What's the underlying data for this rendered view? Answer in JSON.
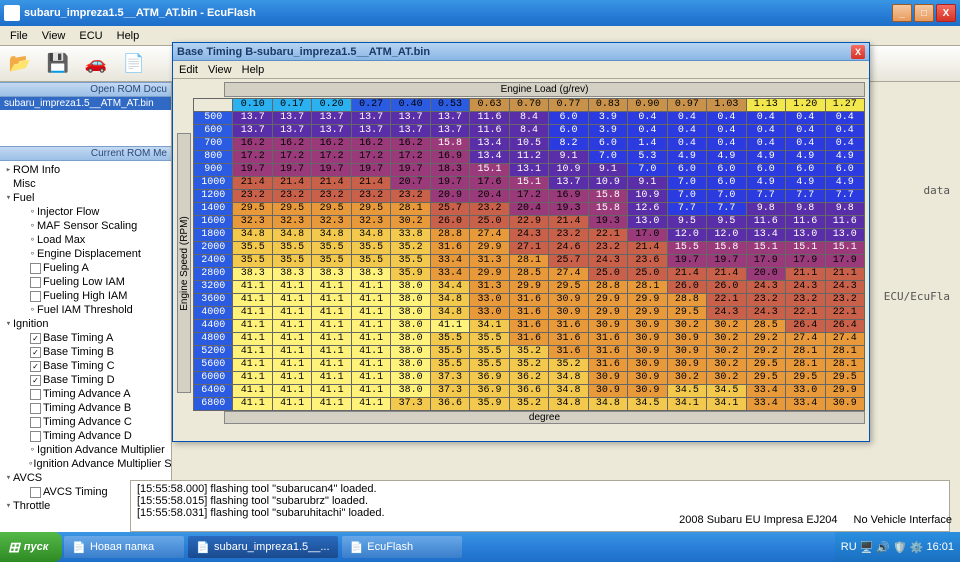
{
  "window": {
    "title": "subaru_impreza1.5__ATM_AT.bin - EcuFlash"
  },
  "menubar": [
    "File",
    "View",
    "ECU",
    "Help"
  ],
  "leftpanel": {
    "hdr1": "Open ROM Docu",
    "rom": "subaru_impreza1.5__ATM_AT.bin",
    "hdr2": "Current ROM Me"
  },
  "tree": [
    {
      "lvl": 0,
      "tw": "▸",
      "txt": "ROM Info"
    },
    {
      "lvl": 0,
      "tw": "",
      "txt": "Misc"
    },
    {
      "lvl": 0,
      "tw": "▾",
      "txt": "Fuel"
    },
    {
      "lvl": 2,
      "tw": "∘",
      "txt": "Injector Flow"
    },
    {
      "lvl": 2,
      "tw": "∘",
      "txt": "MAF Sensor Scaling"
    },
    {
      "lvl": 2,
      "tw": "∘",
      "txt": "Load Max"
    },
    {
      "lvl": 2,
      "tw": "∘",
      "txt": "Engine Displacement"
    },
    {
      "lvl": 2,
      "cb": "",
      "txt": "Fueling A"
    },
    {
      "lvl": 2,
      "cb": "",
      "txt": "Fueling Low IAM"
    },
    {
      "lvl": 2,
      "cb": "",
      "txt": "Fueling High IAM"
    },
    {
      "lvl": 2,
      "tw": "∘",
      "txt": "Fuel IAM Threshold"
    },
    {
      "lvl": 0,
      "tw": "▾",
      "txt": "Ignition"
    },
    {
      "lvl": 2,
      "cb": "✓",
      "txt": "Base Timing A"
    },
    {
      "lvl": 2,
      "cb": "✓",
      "txt": "Base Timing B"
    },
    {
      "lvl": 2,
      "cb": "✓",
      "txt": "Base Timing C"
    },
    {
      "lvl": 2,
      "cb": "✓",
      "txt": "Base Timing D"
    },
    {
      "lvl": 2,
      "cb": "",
      "txt": "Timing Advance A"
    },
    {
      "lvl": 2,
      "cb": "",
      "txt": "Timing Advance B"
    },
    {
      "lvl": 2,
      "cb": "",
      "txt": "Timing Advance C"
    },
    {
      "lvl": 2,
      "cb": "",
      "txt": "Timing Advance D"
    },
    {
      "lvl": 2,
      "tw": "∘",
      "txt": "Ignition Advance Multiplier"
    },
    {
      "lvl": 2,
      "tw": "∘",
      "txt": "Ignition Advance Multiplier Step"
    },
    {
      "lvl": 0,
      "tw": "▾",
      "txt": "AVCS"
    },
    {
      "lvl": 2,
      "cb": "",
      "txt": "AVCS Timing"
    },
    {
      "lvl": 0,
      "tw": "▾",
      "txt": "Throttle"
    }
  ],
  "modal": {
    "title": "Base Timing B-subaru_impreza1.5__ATM_AT.bin",
    "menu": [
      "Edit",
      "View",
      "Help"
    ],
    "top_label": "Engine Load (g/rev)",
    "left_label": "Engine Speed (RPM)",
    "bottom_label": "degree"
  },
  "chart_data": {
    "type": "heatmap",
    "xlabel": "Engine Load (g/rev)",
    "ylabel": "Engine Speed (RPM)",
    "unit": "degree",
    "x": [
      "0.10",
      "0.17",
      "0.20",
      "0.27",
      "0.40",
      "0.53",
      "0.63",
      "0.70",
      "0.77",
      "0.83",
      "0.90",
      "0.97",
      "1.03",
      "1.13",
      "1.20",
      "1.27"
    ],
    "y": [
      "500",
      "600",
      "700",
      "800",
      "900",
      "1000",
      "1200",
      "1400",
      "1600",
      "1800",
      "2000",
      "2400",
      "2800",
      "3200",
      "3600",
      "4000",
      "4400",
      "4800",
      "5200",
      "5600",
      "6000",
      "6400",
      "6800"
    ],
    "values": [
      [
        13.7,
        13.7,
        13.7,
        13.7,
        13.7,
        13.7,
        11.6,
        8.4,
        6.0,
        3.9,
        0.4,
        0.4,
        0.4,
        0.4,
        0.4,
        0.4
      ],
      [
        13.7,
        13.7,
        13.7,
        13.7,
        13.7,
        13.7,
        11.6,
        8.4,
        6.0,
        3.9,
        0.4,
        0.4,
        0.4,
        0.4,
        0.4,
        0.4
      ],
      [
        16.2,
        16.2,
        16.2,
        16.2,
        16.2,
        15.8,
        13.4,
        10.5,
        8.2,
        6.0,
        1.4,
        0.4,
        0.4,
        0.4,
        0.4,
        0.4
      ],
      [
        17.2,
        17.2,
        17.2,
        17.2,
        17.2,
        16.9,
        13.4,
        11.2,
        9.1,
        7.0,
        5.3,
        4.9,
        4.9,
        4.9,
        4.9,
        4.9
      ],
      [
        19.7,
        19.7,
        19.7,
        19.7,
        19.7,
        18.3,
        15.1,
        13.1,
        10.9,
        9.1,
        7.0,
        6.0,
        6.0,
        6.0,
        6.0,
        6.0
      ],
      [
        21.4,
        21.4,
        21.4,
        21.4,
        20.7,
        19.7,
        17.6,
        15.1,
        13.7,
        10.9,
        9.1,
        7.0,
        6.0,
        4.9,
        4.9,
        4.9
      ],
      [
        23.2,
        23.2,
        23.2,
        23.2,
        23.2,
        20.9,
        20.4,
        17.2,
        16.9,
        15.8,
        10.9,
        7.0,
        7.0,
        7.7,
        7.7,
        7.7
      ],
      [
        29.5,
        29.5,
        29.5,
        29.5,
        28.1,
        25.7,
        23.2,
        20.4,
        19.3,
        15.8,
        12.6,
        7.7,
        7.7,
        9.8,
        9.8,
        9.8
      ],
      [
        32.3,
        32.3,
        32.3,
        32.3,
        30.2,
        26.0,
        25.0,
        22.9,
        21.4,
        19.3,
        13.0,
        9.5,
        9.5,
        11.6,
        11.6,
        11.6
      ],
      [
        34.8,
        34.8,
        34.8,
        34.8,
        33.8,
        28.8,
        27.4,
        24.3,
        23.2,
        22.1,
        17.0,
        12.0,
        12.0,
        13.4,
        13.0,
        13.0
      ],
      [
        35.5,
        35.5,
        35.5,
        35.5,
        35.2,
        31.6,
        29.9,
        27.1,
        24.6,
        23.2,
        21.4,
        15.5,
        15.8,
        15.1,
        15.1,
        15.1
      ],
      [
        35.5,
        35.5,
        35.5,
        35.5,
        35.5,
        33.4,
        31.3,
        28.1,
        25.7,
        24.3,
        23.6,
        19.7,
        19.7,
        17.9,
        17.9,
        17.9
      ],
      [
        38.3,
        38.3,
        38.3,
        38.3,
        35.9,
        33.4,
        29.9,
        28.5,
        27.4,
        25.0,
        25.0,
        21.4,
        21.4,
        20.0,
        21.1,
        21.1
      ],
      [
        41.1,
        41.1,
        41.1,
        41.1,
        38.0,
        34.4,
        31.3,
        29.9,
        29.5,
        28.8,
        28.1,
        26.0,
        26.0,
        24.3,
        24.3,
        24.3
      ],
      [
        41.1,
        41.1,
        41.1,
        41.1,
        38.0,
        34.8,
        33.0,
        31.6,
        30.9,
        29.9,
        29.9,
        28.8,
        22.1,
        23.2,
        23.2,
        23.2
      ],
      [
        41.1,
        41.1,
        41.1,
        41.1,
        38.0,
        34.8,
        33.0,
        31.6,
        30.9,
        29.9,
        29.9,
        29.5,
        24.3,
        24.3,
        22.1,
        22.1
      ],
      [
        41.1,
        41.1,
        41.1,
        41.1,
        38.0,
        41.1,
        34.1,
        31.6,
        31.6,
        30.9,
        30.9,
        30.2,
        30.2,
        28.5,
        26.4,
        26.4
      ],
      [
        41.1,
        41.1,
        41.1,
        41.1,
        38.0,
        35.5,
        35.5,
        31.6,
        31.6,
        31.6,
        30.9,
        30.9,
        30.2,
        29.2,
        27.4,
        27.4
      ],
      [
        41.1,
        41.1,
        41.1,
        41.1,
        38.0,
        35.5,
        35.5,
        35.2,
        31.6,
        31.6,
        30.9,
        30.9,
        30.2,
        29.2,
        28.1,
        28.1
      ],
      [
        41.1,
        41.1,
        41.1,
        41.1,
        38.0,
        35.5,
        35.5,
        35.2,
        35.2,
        31.6,
        30.9,
        30.9,
        30.2,
        29.5,
        28.1,
        28.1
      ],
      [
        41.1,
        41.1,
        41.1,
        41.1,
        38.0,
        37.3,
        36.9,
        36.2,
        34.8,
        30.9,
        30.9,
        30.2,
        30.2,
        29.5,
        29.5,
        29.5
      ],
      [
        41.1,
        41.1,
        41.1,
        41.1,
        38.0,
        37.3,
        36.9,
        36.6,
        34.8,
        30.9,
        30.9,
        34.5,
        34.5,
        33.4,
        33.0,
        29.9
      ],
      [
        41.1,
        41.1,
        41.1,
        41.1,
        37.3,
        36.6,
        35.9,
        35.2,
        34.8,
        34.8,
        34.5,
        34.1,
        34.1,
        33.4,
        33.4,
        30.9
      ]
    ]
  },
  "log": [
    "[15:55:58.000] flashing tool \"subarucan4\" loaded.",
    "[15:55:58.015] flashing tool \"subarubrz\" loaded.",
    "[15:55:58.031] flashing tool \"subaruhitachi\" loaded."
  ],
  "bg_text": [
    "data",
    "ECU/EcuFla"
  ],
  "status": {
    "left": "2008 Subaru EU Impresa EJ204",
    "right": "No Vehicle Interface"
  },
  "taskbar": {
    "start": "пуск",
    "items": [
      "Новая папка",
      "subaru_impreza1.5__...",
      "EcuFlash"
    ],
    "lang": "RU",
    "clock": "16:01"
  }
}
